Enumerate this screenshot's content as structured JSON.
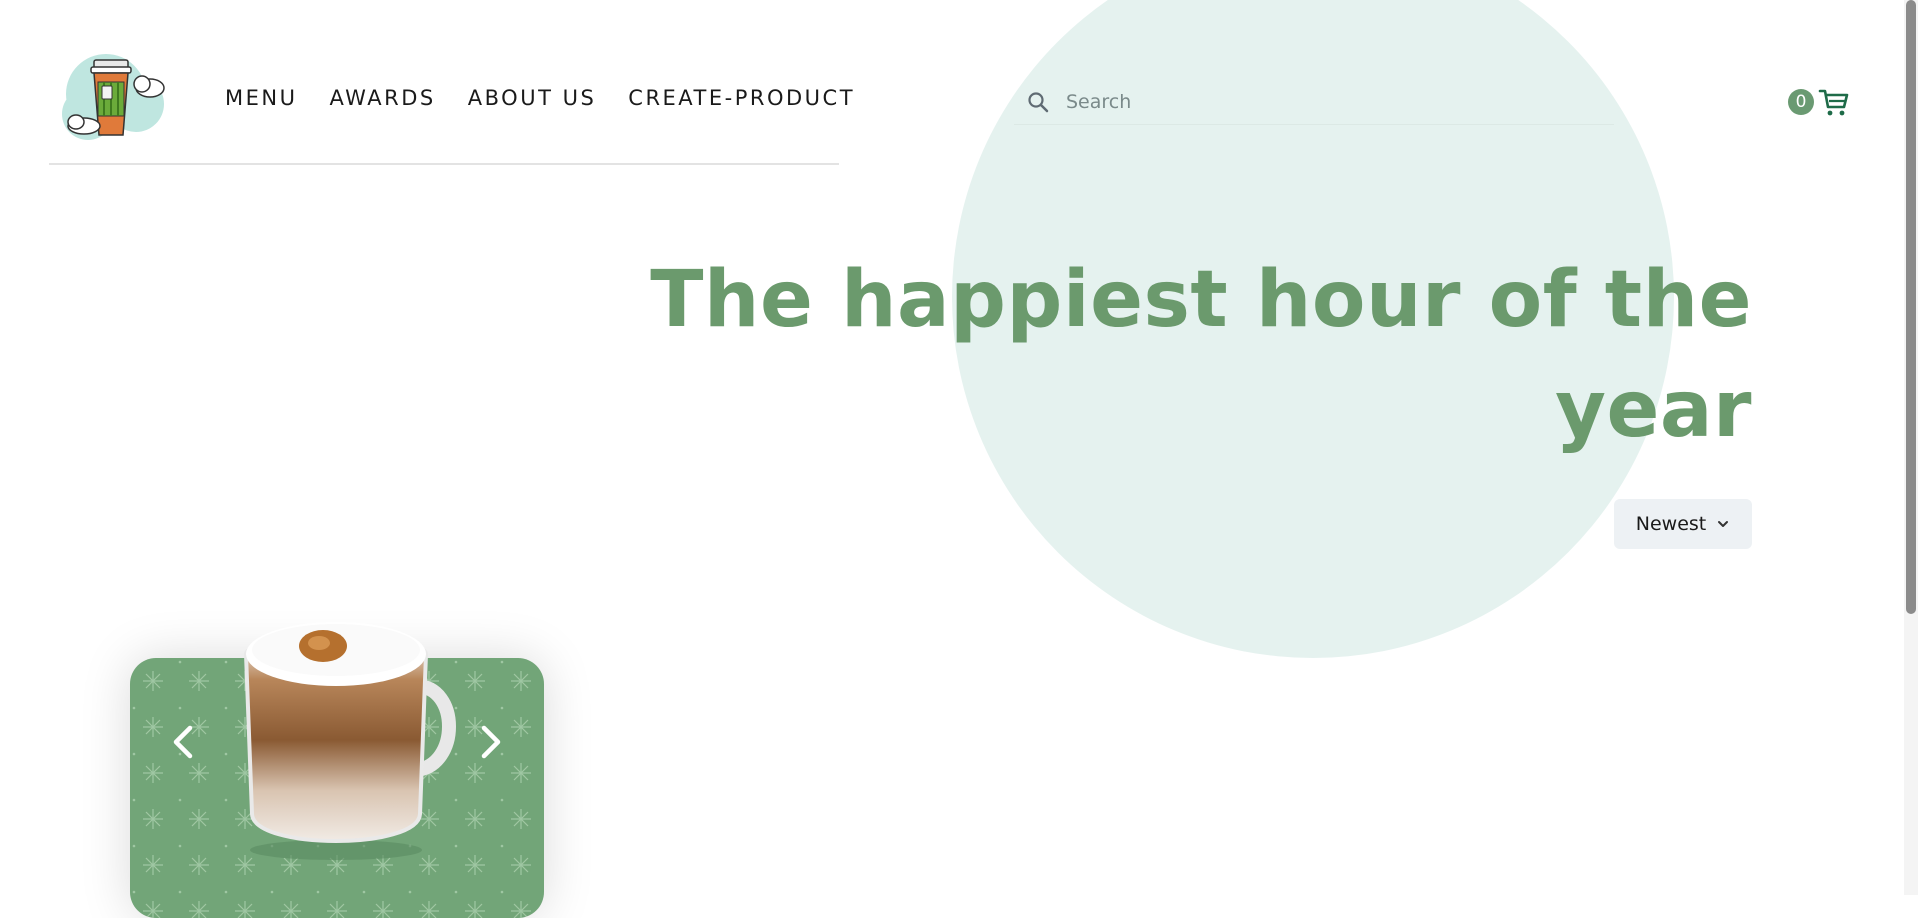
{
  "nav": {
    "items": [
      {
        "label": "MENU"
      },
      {
        "label": "AWARDS"
      },
      {
        "label": "ABOUT US"
      },
      {
        "label": "CREATE-PRODUCT"
      }
    ]
  },
  "search": {
    "placeholder": "Search",
    "value": ""
  },
  "cart": {
    "count": "0"
  },
  "hero": {
    "title": "The happiest hour of the year"
  },
  "sort": {
    "selected": "Newest"
  },
  "icons": {
    "logo": "coffee-cup-cloud-logo",
    "search": "search-icon",
    "cart": "cart-icon",
    "sort": "chevron-down-icon",
    "carousel_prev": "chevron-left-icon",
    "carousel_next": "chevron-right-icon"
  },
  "colors": {
    "accent": "#6b9a6d",
    "circle": "#e5f2ef",
    "card": "#72a578",
    "cart_badge": "#6a9a72",
    "cart_icon": "#1e6b48"
  }
}
